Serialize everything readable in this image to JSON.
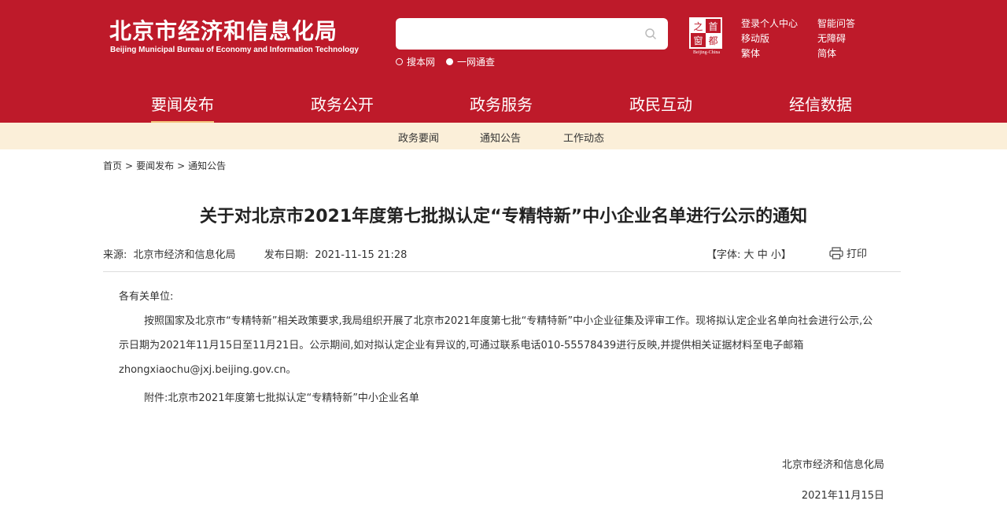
{
  "header": {
    "site_name_cn": "北京市经济和信息化局",
    "site_name_en": "Beijing Municipal Bureau of Economy and Information Technology",
    "search": {
      "placeholder": "",
      "opt1": "搜本网",
      "opt2": "一网通查"
    },
    "seal": {
      "c1": "首",
      "c2": "之",
      "c3": "都",
      "c4": "窗",
      "caption": "Beijing-China"
    },
    "links": [
      "登录个人中心",
      "智能问答",
      "移动版",
      "无障碍",
      "繁体",
      "简体"
    ]
  },
  "nav": {
    "items": [
      "要闻发布",
      "政务公开",
      "政务服务",
      "政民互动",
      "经信数据"
    ],
    "active_index": 0
  },
  "subnav": {
    "items": [
      "政务要闻",
      "通知公告",
      "工作动态"
    ]
  },
  "breadcrumb": {
    "items": [
      "首页",
      "要闻发布",
      "通知公告"
    ],
    "separator": ">"
  },
  "article": {
    "title": "关于对北京市2021年度第七批拟认定“专精特新”中小企业名单进行公示的通知",
    "source_label": "来源:",
    "source": "北京市经济和信息化局",
    "date_label": "发布日期:",
    "date": "2021-11-15 21:28",
    "font_label": "【字体:",
    "font_large": "大",
    "font_medium": "中",
    "font_small": "小",
    "font_close": "】",
    "print_label": "打印",
    "salutation": "各有关单位:",
    "body": "按照国家及北京市“专精特新”相关政策要求,我局组织开展了北京市2021年度第七批“专精特新”中小企业征集及评审工作。现将拟认定企业名单向社会进行公示,公示日期为2021年11月15日至11月21日。公示期间,如对拟认定企业有异议的,可通过联系电话010-55578439进行反映,并提供相关证据材料至电子邮箱zhongxiaochu@jxj.beijing.gov.cn。",
    "attachment": "附件:北京市2021年度第七批拟认定“专精特新”中小企业名单",
    "sign_org": "北京市经济和信息化局",
    "sign_date": "2021年11月15日"
  },
  "colors": {
    "brand_red": "#be1a2a",
    "subnav_bg": "#fbefd9",
    "active_underline": "#f4c27a"
  }
}
